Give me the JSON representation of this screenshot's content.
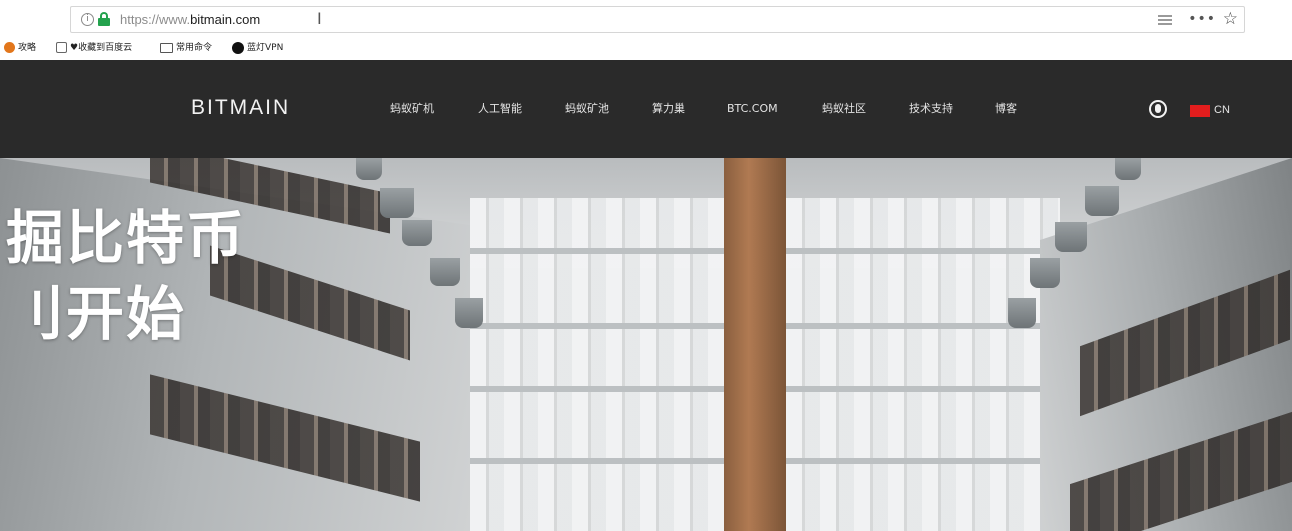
{
  "browser": {
    "url_prefix": "https://www.",
    "url_host": "bitmain.com",
    "info_icon": "info-icon",
    "lock_icon": "lock-icon",
    "reader_icon": "reader-mode-icon",
    "more_label": "•••",
    "star_icon": "☆",
    "bookmarks": [
      {
        "icon": "flame-icon",
        "label": "攻略"
      },
      {
        "icon": "bookmark-icon",
        "label": "♥收藏到百度云"
      },
      {
        "icon": "folder-icon",
        "label": "常用命令"
      },
      {
        "icon": "github-icon",
        "label": "蓝灯VPN"
      }
    ]
  },
  "site": {
    "logo": "BITMAIN",
    "nav": [
      "蚂蚁矿机",
      "人工智能",
      "蚂蚁矿池",
      "算力巢",
      "BTC.COM",
      "蚂蚁社区",
      "技术支持",
      "博客"
    ],
    "lang_label": "CN",
    "colors": {
      "header_bg": "#2a2a2a",
      "flag_red": "#e21d1d",
      "secure_green": "#23a24d"
    },
    "hero": {
      "line1": "掘比特币",
      "line2": "刂开始"
    }
  }
}
